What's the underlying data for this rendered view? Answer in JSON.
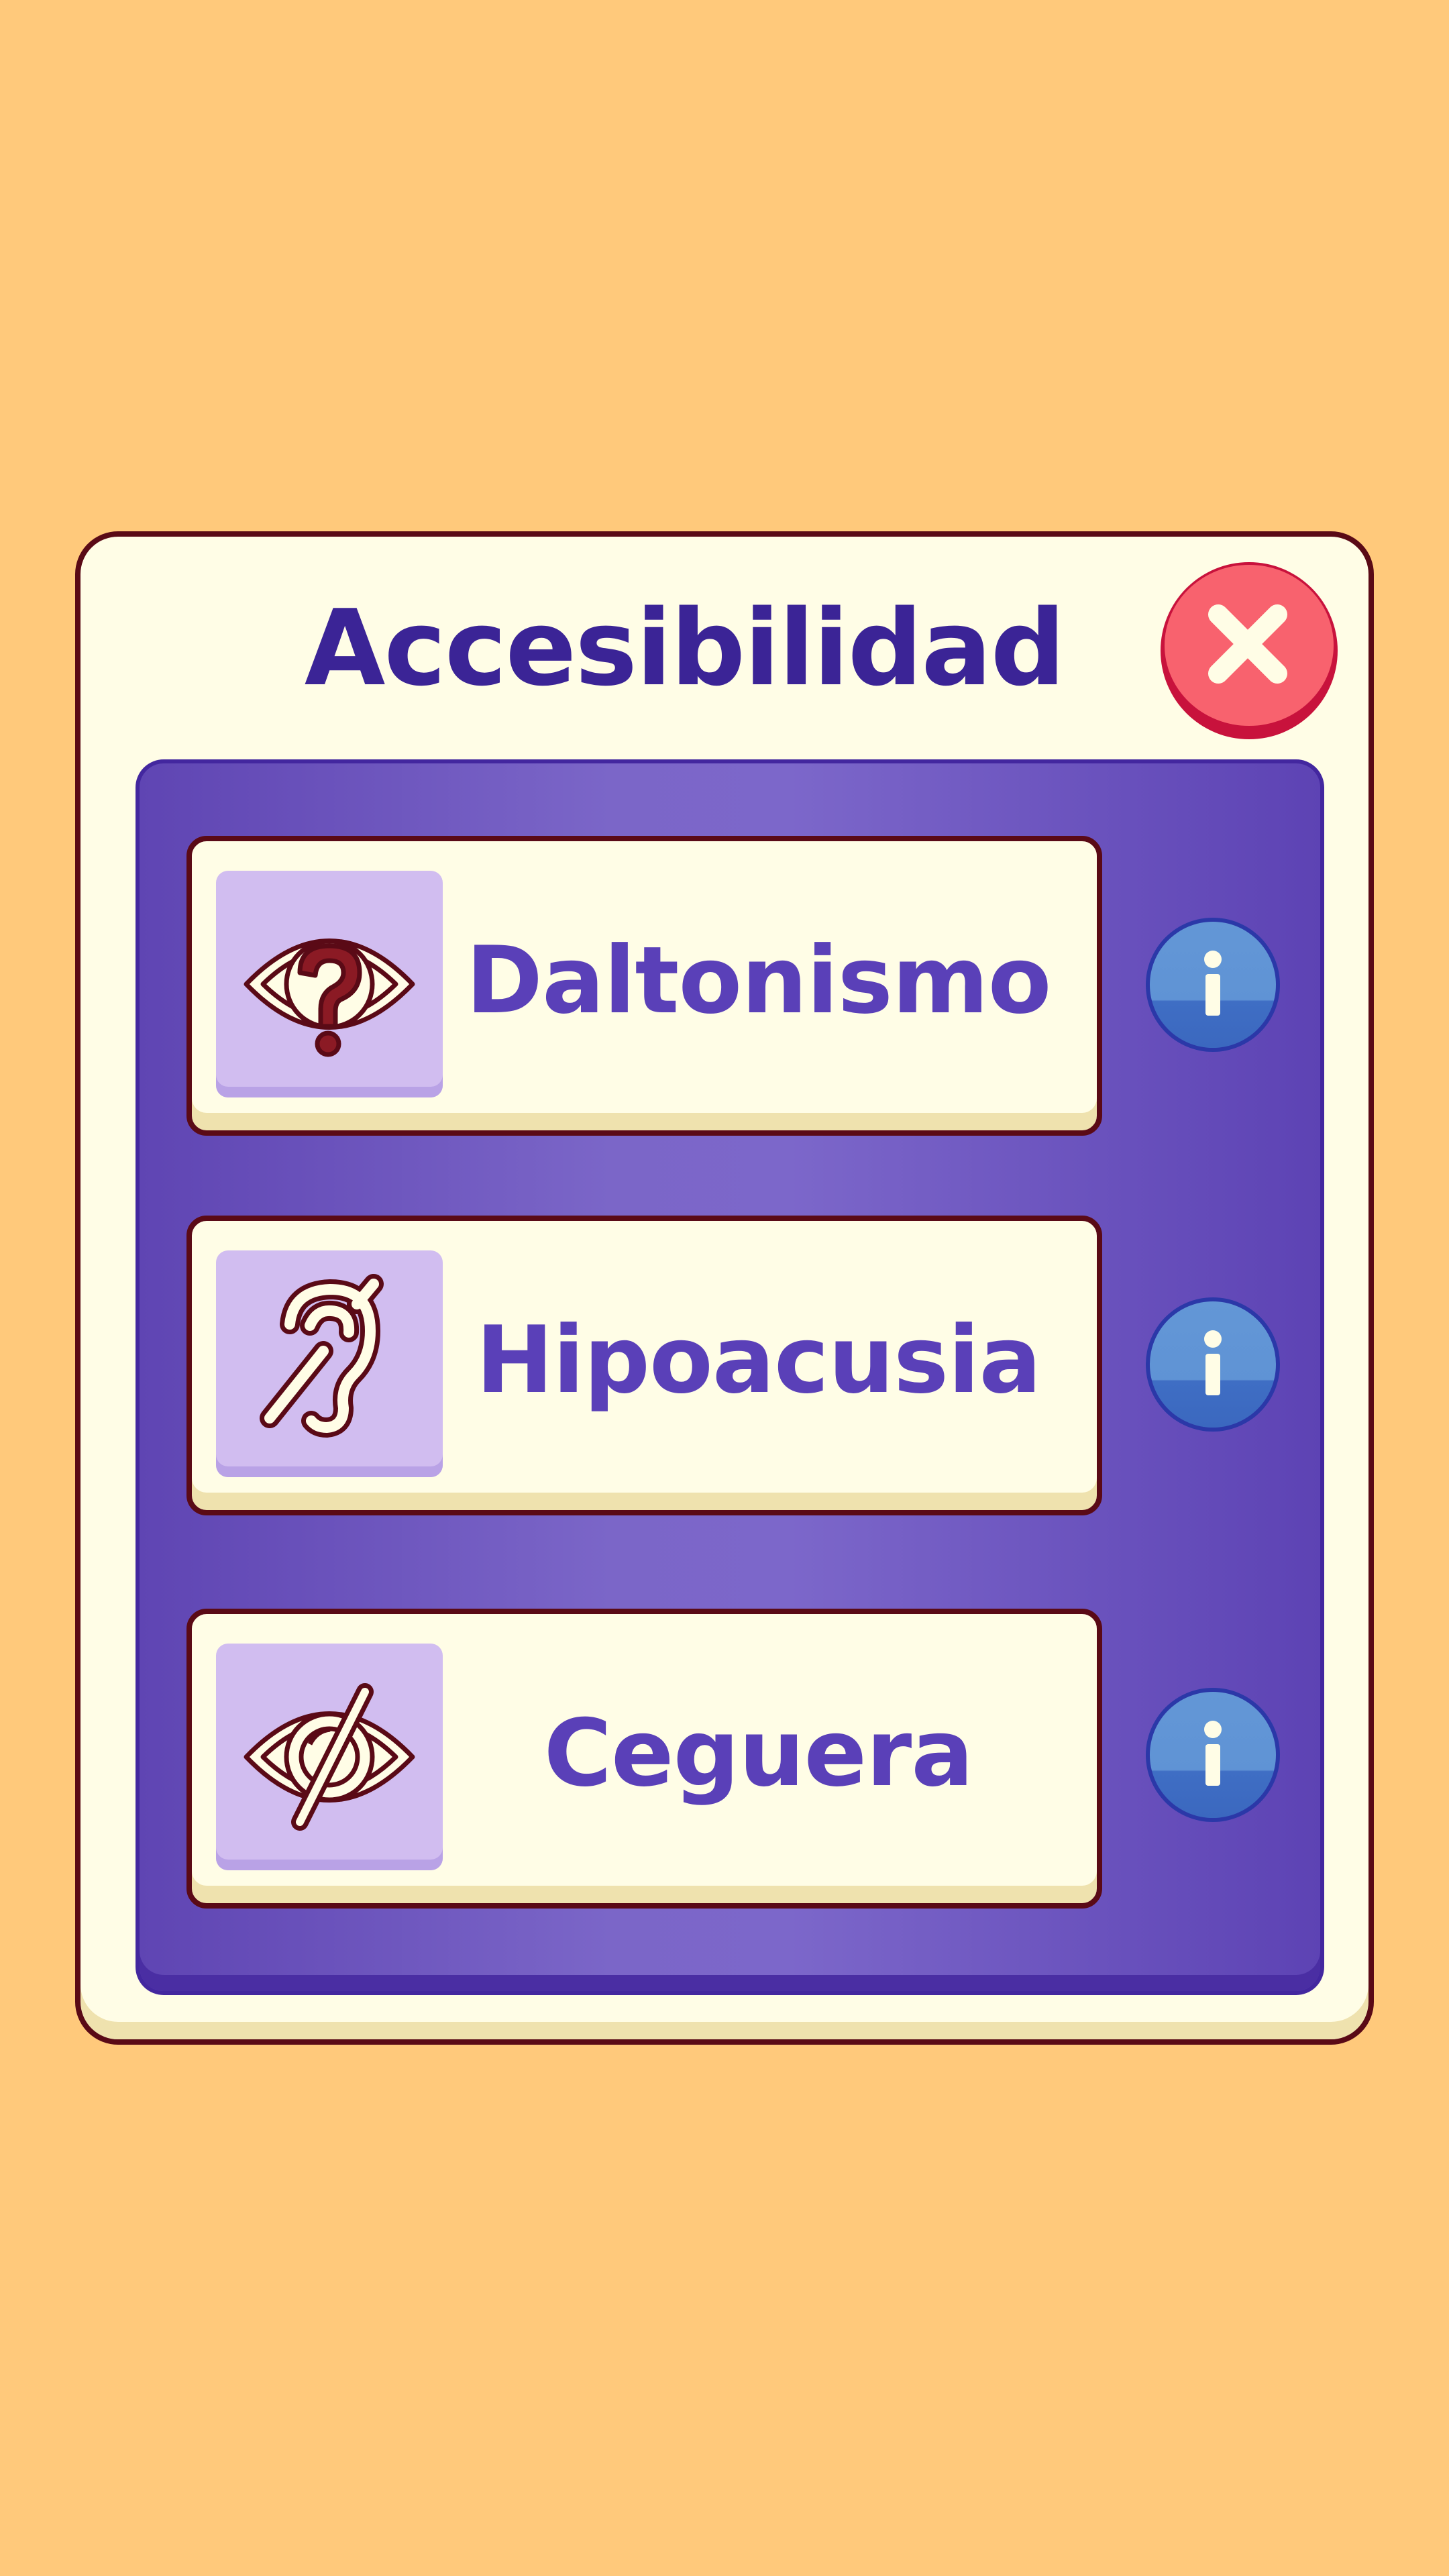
{
  "theme": {
    "background": "#ffc97b",
    "panel": "#6a52bd",
    "card": "#fffde6",
    "title_color": "#3b2496",
    "label_color": "#5a40b8",
    "close_color": "#f8626e",
    "info_color": "#5f93d5"
  },
  "dialog": {
    "title": "Accesibilidad",
    "close_icon": "close-x-icon"
  },
  "options": [
    {
      "label": "Daltonismo",
      "icon": "eye-question-icon",
      "info_icon": "info-icon"
    },
    {
      "label": "Hipoacusia",
      "icon": "ear-slash-icon",
      "info_icon": "info-icon"
    },
    {
      "label": "Ceguera",
      "icon": "eye-slash-icon",
      "info_icon": "info-icon"
    }
  ]
}
